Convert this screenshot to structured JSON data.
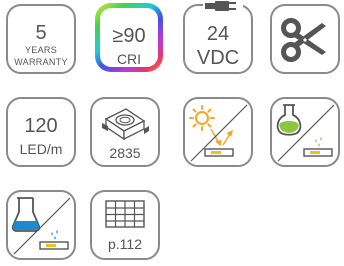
{
  "warranty": {
    "years": "5",
    "line1": "YEARS",
    "line2": "WARRANTY"
  },
  "cri": {
    "value": "≥90",
    "label": "CRI"
  },
  "voltage": {
    "value": "24",
    "unit": "VDC"
  },
  "density": {
    "value": "120",
    "unit": "LED/m"
  },
  "chip": {
    "label": "2835"
  },
  "page_ref": {
    "label": "p.112"
  },
  "colors": {
    "border": "#8a8a8a",
    "text": "#555555",
    "sun": "#f5a623",
    "water": "#1e88d0",
    "chemical": "#8cc63f",
    "led_strip": "#f0c020"
  }
}
